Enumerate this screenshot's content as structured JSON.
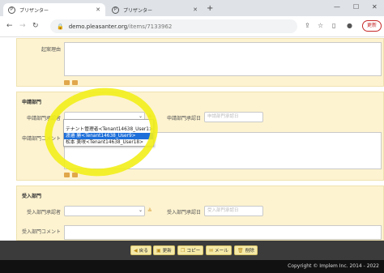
{
  "browser": {
    "tabs": [
      {
        "title": "プリザンター",
        "active": true
      },
      {
        "title": "プリザンター",
        "active": false
      }
    ],
    "url_domain": "demo.pleasanter.org",
    "url_path": "/items/7133962",
    "profile_label": "更新"
  },
  "form": {
    "reason_label": "起案理由",
    "apply_section": {
      "title": "申請部門",
      "approver_label": "申請部門承認者",
      "approval_date_label": "申請部門承認日",
      "approval_date_placeholder": "申請部門承認日",
      "comment_label": "申請部門コメント"
    },
    "receive_section": {
      "title": "受入部門",
      "approver_label": "受入部門承認者",
      "approval_date_label": "受入部門承認日",
      "approval_date_placeholder": "受入部門承認日",
      "comment_label": "受入部門コメント"
    },
    "dropdown_options": [
      {
        "label": "",
        "selected": false
      },
      {
        "label": "テナント管理者<Tenant14638_User1>",
        "selected": false
      },
      {
        "label": "渡邉 勝<Tenant14638_User9>",
        "selected": true
      },
      {
        "label": "松本 美咲<Tenant14638_User18>",
        "selected": false
      }
    ]
  },
  "toolbar": {
    "back": "戻る",
    "update": "更新",
    "copy": "コピー",
    "mail": "メール",
    "delete": "削除"
  },
  "footer": {
    "copyright": "Copyright © Implem Inc. 2014 - 2022"
  },
  "colors": {
    "section_bg": "#fdf3d0",
    "highlight": "#f2ee1a",
    "selected_option": "#1e6fd9",
    "button_bg": "#f5e9a8"
  }
}
